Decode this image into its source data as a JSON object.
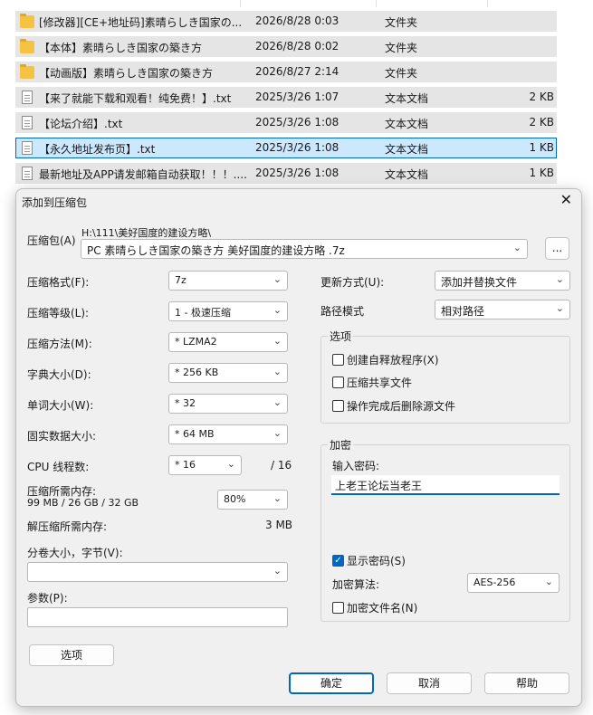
{
  "files": [
    {
      "name": "[修改器][CE+地址码]素晴らしき国家の...",
      "date": "2026/8/28 0:03",
      "type": "文件夹",
      "size": "",
      "icon": "folder-icon",
      "selected": false
    },
    {
      "name": "【本体】素晴らしき国家の築き方",
      "date": "2026/8/28 0:02",
      "type": "文件夹",
      "size": "",
      "icon": "folder-icon",
      "selected": false
    },
    {
      "name": "【动画版】素晴らしき国家の築き方",
      "date": "2026/8/27 2:14",
      "type": "文件夹",
      "size": "",
      "icon": "folder-icon",
      "selected": false
    },
    {
      "name": "【来了就能下载和观看！纯免费！】.txt",
      "date": "2025/3/26 1:07",
      "type": "文本文档",
      "size": "2 KB",
      "icon": "txt-icon",
      "selected": false
    },
    {
      "name": "【论坛介绍】.txt",
      "date": "2025/3/26 1:08",
      "type": "文本文档",
      "size": "2 KB",
      "icon": "txt-icon",
      "selected": false
    },
    {
      "name": "【永久地址发布页】.txt",
      "date": "2025/3/26 1:08",
      "type": "文本文档",
      "size": "1 KB",
      "icon": "txt-icon",
      "selected": true
    },
    {
      "name": "最新地址及APP请发邮箱自动获取！！！....",
      "date": "2025/3/26 1:08",
      "type": "文本文档",
      "size": "1 KB",
      "icon": "txt-icon",
      "selected": false
    }
  ],
  "dialog": {
    "title": "添加到压缩包",
    "close": "✕",
    "archive_label": "压缩包(A)",
    "archive_path": "H:\\111\\美好国度的建设方略\\",
    "archive_name": "PC 素晴らしき国家の築き方 美好国度的建设方略 .7z",
    "browse_label": "...",
    "format_label": "压缩格式(F):",
    "format_value": "7z",
    "level_label": "压缩等级(L):",
    "level_value": "1 - 极速压缩",
    "method_label": "压缩方法(M):",
    "method_value": "*  LZMA2",
    "dict_label": "字典大小(D):",
    "dict_value": "*  256 KB",
    "word_label": "单词大小(W):",
    "word_value": "*  32",
    "solid_label": "固实数据大小:",
    "solid_value": "*  64 MB",
    "cpu_label": "CPU 线程数:",
    "cpu_value": "*  16",
    "cpu_max": "/ 16",
    "mem_label": "压缩所需内存:",
    "mem_detail": "99 MB / 26 GB / 32 GB",
    "mem_percent": "80%",
    "decomp_label": "解压缩所需内存:",
    "decomp_value": "3 MB",
    "split_label": "分卷大小，字节(V):",
    "split_value": "",
    "params_label": "参数(P):",
    "params_value": "",
    "options_button": "选项",
    "update_label": "更新方式(U):",
    "update_value": "添加并替换文件",
    "path_label": "路径模式",
    "path_value": "相对路径",
    "options_group": "选项",
    "opt_sfx": "创建自释放程序(X)",
    "opt_shared": "压缩共享文件",
    "opt_delete": "操作完成后删除源文件",
    "encrypt_group": "加密",
    "pw_label": "输入密码:",
    "pw_value": "上老王论坛当老王",
    "show_pw": "显示密码(S)",
    "enc_method_label": "加密算法:",
    "enc_method_value": "AES-256",
    "enc_names": "加密文件名(N)",
    "ok": "确定",
    "cancel": "取消",
    "help": "帮助"
  }
}
